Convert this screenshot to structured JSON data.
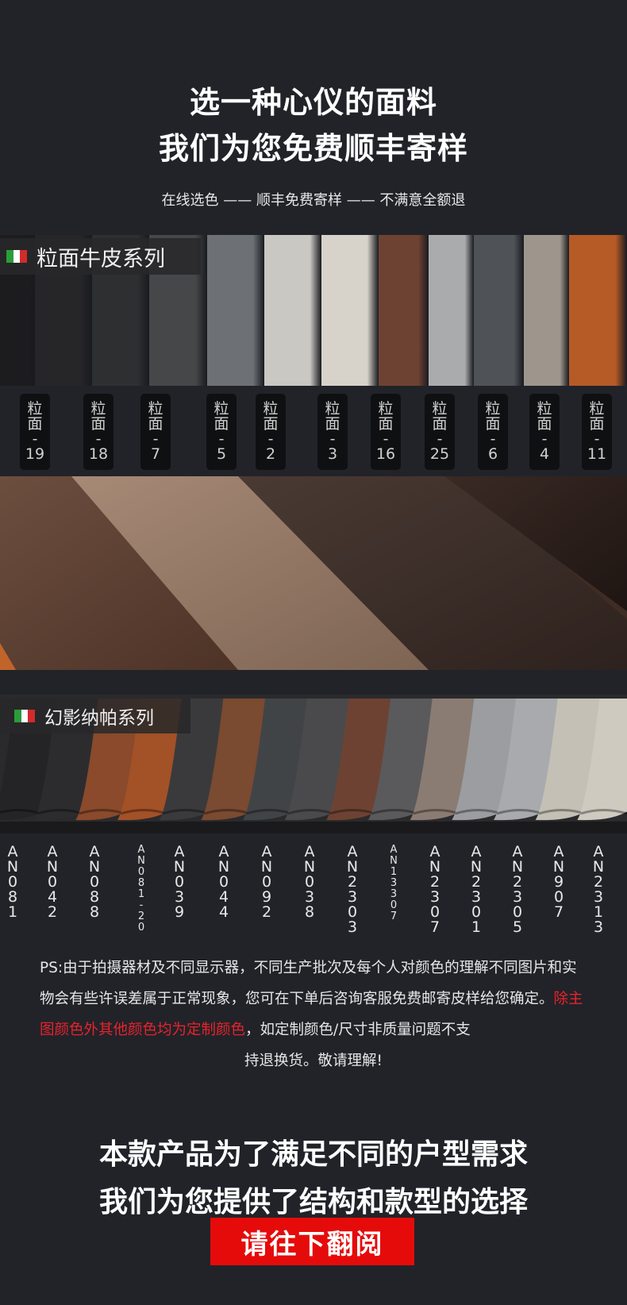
{
  "header": {
    "title_line1": "选一种心仪的面料",
    "title_line2": "我们为您免费顺丰寄样",
    "subtitle": "在线选色 —— 顺丰免费寄样 —— 不满意全额退"
  },
  "series1": {
    "title": "粒面牛皮系列",
    "flag_colors": [
      "#2a9d3a",
      "#ffffff",
      "#d22b2b"
    ],
    "swatch_colors": [
      "#1c1c1e",
      "#262628",
      "#2e2f31",
      "#454749",
      "#6d7175",
      "#c9c8c3",
      "#d7d3ca",
      "#6d4233",
      "#a9abac",
      "#4f5358",
      "#9e968d",
      "#b65a26"
    ],
    "labels": [
      {
        "chars": [
          "粒",
          "面",
          "-",
          "19"
        ]
      },
      {
        "chars": [
          "粒",
          "面",
          "-",
          "18"
        ]
      },
      {
        "chars": [
          "粒",
          "面",
          "-",
          "7"
        ]
      },
      {
        "chars": [
          "粒",
          "面",
          "-",
          "5"
        ]
      },
      {
        "chars": [
          "粒",
          "面",
          "-",
          "2"
        ]
      },
      {
        "chars": [
          "粒",
          "面",
          "-",
          "3"
        ]
      },
      {
        "chars": [
          "粒",
          "面",
          "-",
          "16"
        ]
      },
      {
        "chars": [
          "粒",
          "面",
          "-",
          "25"
        ]
      },
      {
        "chars": [
          "粒",
          "面",
          "-",
          "6"
        ]
      },
      {
        "chars": [
          "粒",
          "面",
          "-",
          "4"
        ]
      },
      {
        "chars": [
          "粒",
          "面",
          "-",
          "11"
        ]
      }
    ]
  },
  "series2": {
    "title": "幻影纳帕系列",
    "flag_colors": [
      "#2a9d3a",
      "#ffffff",
      "#d22b2b"
    ],
    "swatch_colors": [
      "#242426",
      "#2c2c2e",
      "#8a4a2b",
      "#a35127",
      "#3a3a3c",
      "#7a4a31",
      "#414447",
      "#4a4a4c",
      "#6e4232",
      "#5a5a5c",
      "#8b7c73",
      "#9b9da0",
      "#a8aaad",
      "#c4c0b5",
      "#cfcac0"
    ],
    "codes": [
      {
        "chars": [
          "A",
          "N",
          "0",
          "8",
          "1"
        ],
        "small": false
      },
      {
        "chars": [
          "A",
          "N",
          "0",
          "4",
          "2"
        ],
        "small": false
      },
      {
        "chars": [
          "A",
          "N",
          "0",
          "8",
          "8"
        ],
        "small": false
      },
      {
        "chars": [
          "A",
          "N",
          "0",
          "8",
          "1",
          "-",
          "2",
          "0"
        ],
        "small": true
      },
      {
        "chars": [
          "A",
          "N",
          "0",
          "3",
          "9"
        ],
        "small": false
      },
      {
        "chars": [
          "A",
          "N",
          "0",
          "4",
          "4"
        ],
        "small": false
      },
      {
        "chars": [
          "A",
          "N",
          "0",
          "9",
          "2"
        ],
        "small": false
      },
      {
        "chars": [
          "A",
          "N",
          "0",
          "3",
          "8"
        ],
        "small": false
      },
      {
        "chars": [
          "A",
          "N",
          "2",
          "3",
          "0",
          "3"
        ],
        "small": false
      },
      {
        "chars": [
          "A",
          "N",
          "1",
          "3",
          "3",
          "0",
          "7"
        ],
        "small": true
      },
      {
        "chars": [
          "A",
          "N",
          "2",
          "3",
          "0",
          "7"
        ],
        "small": false
      },
      {
        "chars": [
          "A",
          "N",
          "2",
          "3",
          "0",
          "1"
        ],
        "small": false
      },
      {
        "chars": [
          "A",
          "N",
          "2",
          "3",
          "0",
          "5"
        ],
        "small": false
      },
      {
        "chars": [
          "A",
          "N",
          "9",
          "0",
          "7"
        ],
        "small": false
      },
      {
        "chars": [
          "A",
          "N",
          "2",
          "3",
          "1",
          "3"
        ],
        "small": false
      }
    ]
  },
  "note": {
    "part1": "PS:由于拍摄器材及不同显示器，不同生产批次及每个人对颜色的理解不同图片和实物会有些许误差属于正常现象，您可在下单后咨询客服免费邮寄皮样给您确定。",
    "red": "除主图颜色外其他颜色均为定制颜色",
    "part2": "，如定制颜色/尺寸非质量问题不支",
    "last_line": "持退换货。敬请理解!"
  },
  "footer": {
    "line1": "本款产品为了满足不同的户型需求",
    "line2": "我们为您提供了结构和款型的选择",
    "cta": "请往下翻阅"
  },
  "colors": {
    "background": "#212329",
    "accent_red": "#e50b0b",
    "note_red": "#e8222a"
  }
}
